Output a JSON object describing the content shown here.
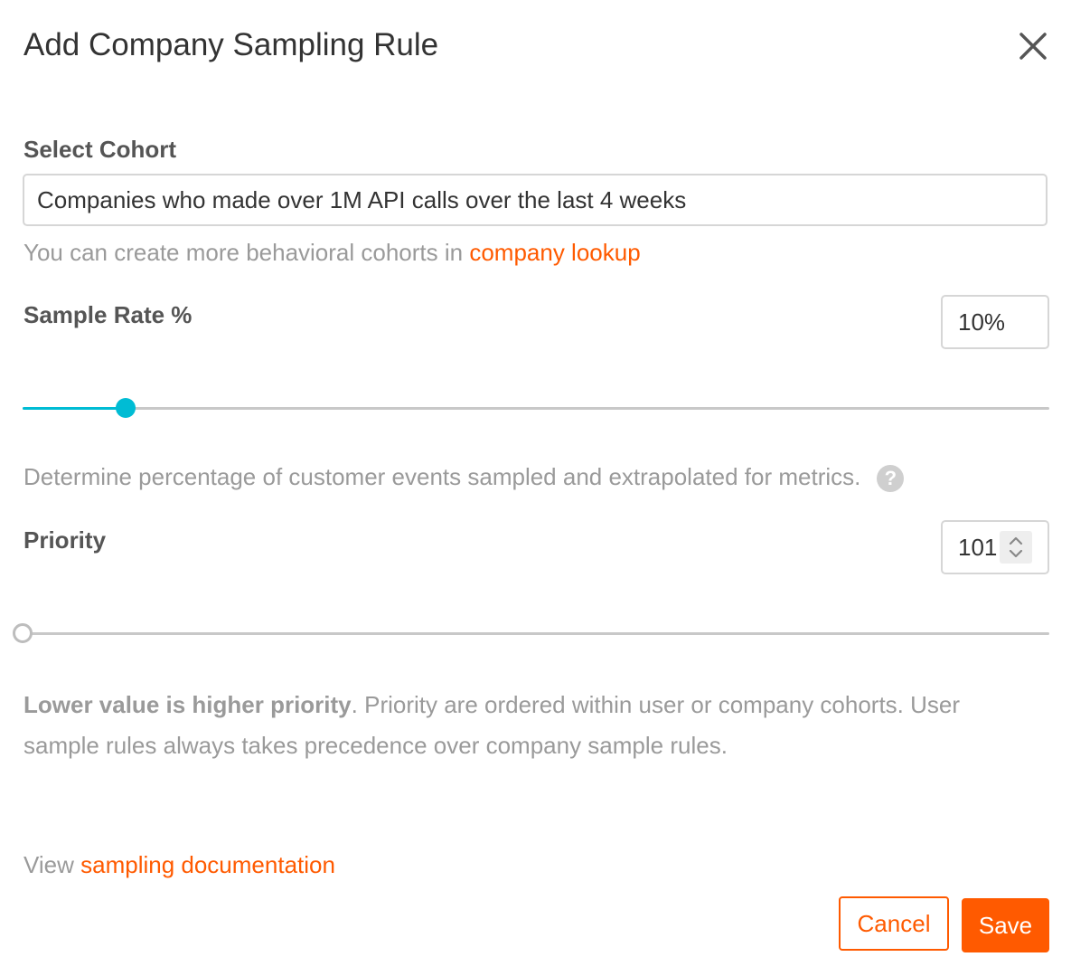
{
  "dialog": {
    "title": "Add Company Sampling Rule",
    "close_icon": "close-icon"
  },
  "cohort": {
    "label": "Select Cohort",
    "value": "Companies who made over 1M API calls over the last 4 weeks",
    "help_prefix": "You can create more behavioral cohorts in ",
    "help_link": "company lookup"
  },
  "sample_rate": {
    "label": "Sample Rate %",
    "value_text": "10%",
    "value_fraction": 0.1,
    "description": "Determine percentage of customer events sampled and extrapolated for metrics.",
    "help_icon": "question-mark-icon",
    "help_icon_glyph": "?"
  },
  "priority": {
    "label": "Priority",
    "value": "101",
    "spinner_icon": "up-down-chevron-icon",
    "slider_fraction": 0,
    "note_bold": "Lower value is higher priority",
    "note_rest": ". Priority are ordered within user or company cohorts. User sample rules always takes precedence over company sample rules."
  },
  "footer": {
    "view_prefix": "View ",
    "doc_link": "sampling documentation",
    "cancel_label": "Cancel",
    "save_label": "Save"
  },
  "colors": {
    "accent": "#ff5a00",
    "slider_active": "#00bcd4",
    "muted_text": "#9a9a9a"
  }
}
